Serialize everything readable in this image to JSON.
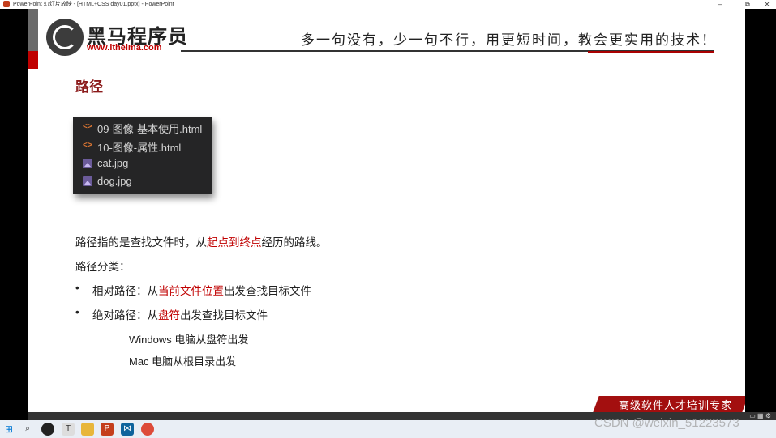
{
  "window": {
    "title": "PowerPoint 幻灯片放映 - [HTML+CSS day01.pptx] - PowerPoint",
    "controls": [
      "–",
      "⧉",
      "✕"
    ]
  },
  "logo": {
    "name": "黑马程序员",
    "url": "www.itheima.com"
  },
  "slogan": "多一句没有，少一句不行，用更短时间，教会更实用的技术！",
  "slide": {
    "heading": "路径",
    "files": [
      {
        "type": "code",
        "icon": "<>",
        "name": "09-图像-基本使用.html"
      },
      {
        "type": "code",
        "icon": "<>",
        "name": "10-图像-属性.html"
      },
      {
        "type": "image",
        "icon": "",
        "name": "cat.jpg"
      },
      {
        "type": "image",
        "icon": "",
        "name": "dog.jpg"
      }
    ],
    "definition": {
      "prefix": "路径指的是查找文件时，从",
      "highlight": "起点到终点",
      "suffix": "经历的路线。"
    },
    "category_title": "路径分类：",
    "bullet_symbol": "•",
    "relative": {
      "prefix": "相对路径：从",
      "highlight": "当前文件位置",
      "suffix": "出发查找目标文件"
    },
    "absolute": {
      "prefix": "绝对路径：从",
      "highlight": "盘符",
      "suffix": "出发查找目标文件"
    },
    "notes": [
      "Windows 电脑从盘符出发",
      "Mac 电脑从根目录出发"
    ],
    "footer_banner": "高级软件人才培训专家"
  },
  "watermark": "CSDN @weixin_51223573",
  "colors": {
    "brand_red": "#c00000",
    "heading_red": "#8b1a1a",
    "panel_bg": "#252526"
  }
}
